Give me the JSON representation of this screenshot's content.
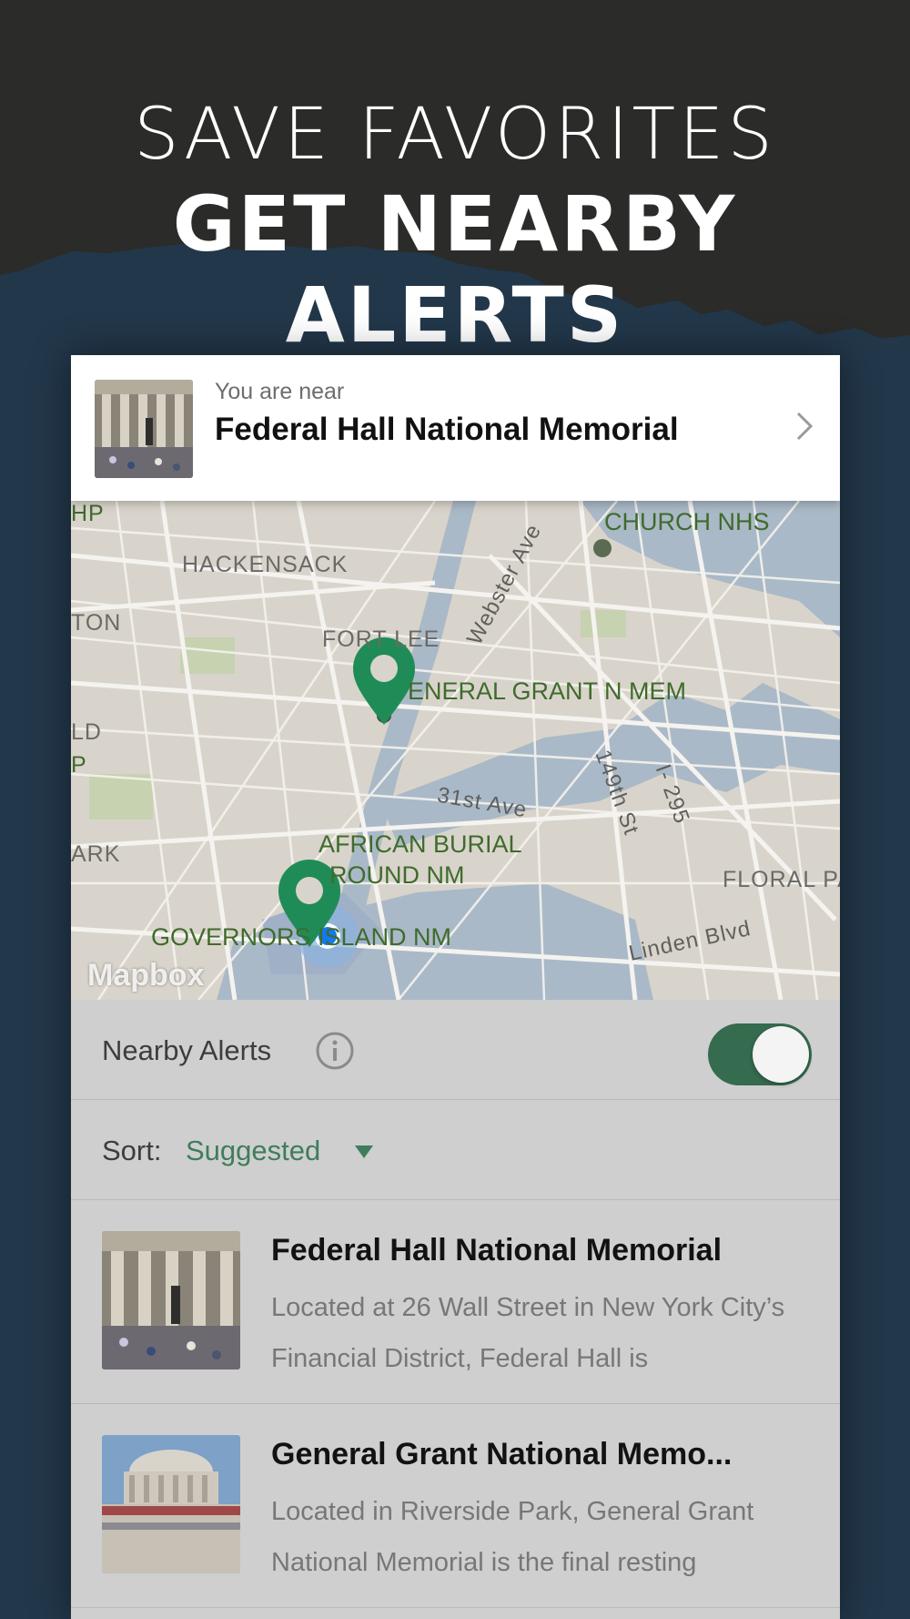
{
  "hero": {
    "line1": "SAVE FAVORITES",
    "line2": "GET NEARBY ALERTS"
  },
  "near_card": {
    "label": "You are near",
    "title": "Federal Hall National Memorial",
    "chevron_icon": "chevron-right-icon"
  },
  "map": {
    "labels": {
      "hp": "HP",
      "church": "CHURCH NHS",
      "hackensack": "HACKENSACK",
      "ton": "TON",
      "fort_lee": "FORT LEE",
      "webster": "Webster Ave",
      "grant": "ENERAL GRANT N MEM",
      "ld": "LD",
      "p": "P",
      "st149": "149th St",
      "i295": "I- 295",
      "ave31": "31st Ave",
      "african1": "AFRICAN BURIAL",
      "african2": "ROUND NM",
      "ark": "ARK",
      "floral": "FLORAL PA",
      "governors": "GOVERNORS ISLAND NM",
      "linden": "Linden Blvd"
    },
    "attribution": "Mapbox",
    "colors": {
      "water": "#aab9c7",
      "land": "#d9d4cb",
      "park": "#c6d2b0",
      "pin": "#1f8c57",
      "location": "#1479f0"
    }
  },
  "alerts": {
    "label": "Nearby Alerts",
    "info_icon": "info-icon",
    "enabled": true
  },
  "sort": {
    "label": "Sort:",
    "value": "Suggested",
    "caret_icon": "caret-down-icon"
  },
  "list": [
    {
      "title": "Federal Hall National Memorial",
      "description": "Located at 26 Wall Street in New York City’s Financial District, Federal Hall is"
    },
    {
      "title": "General Grant National Memo...",
      "description": "Located in Riverside Park, General Grant National Memorial is the final resting"
    }
  ]
}
